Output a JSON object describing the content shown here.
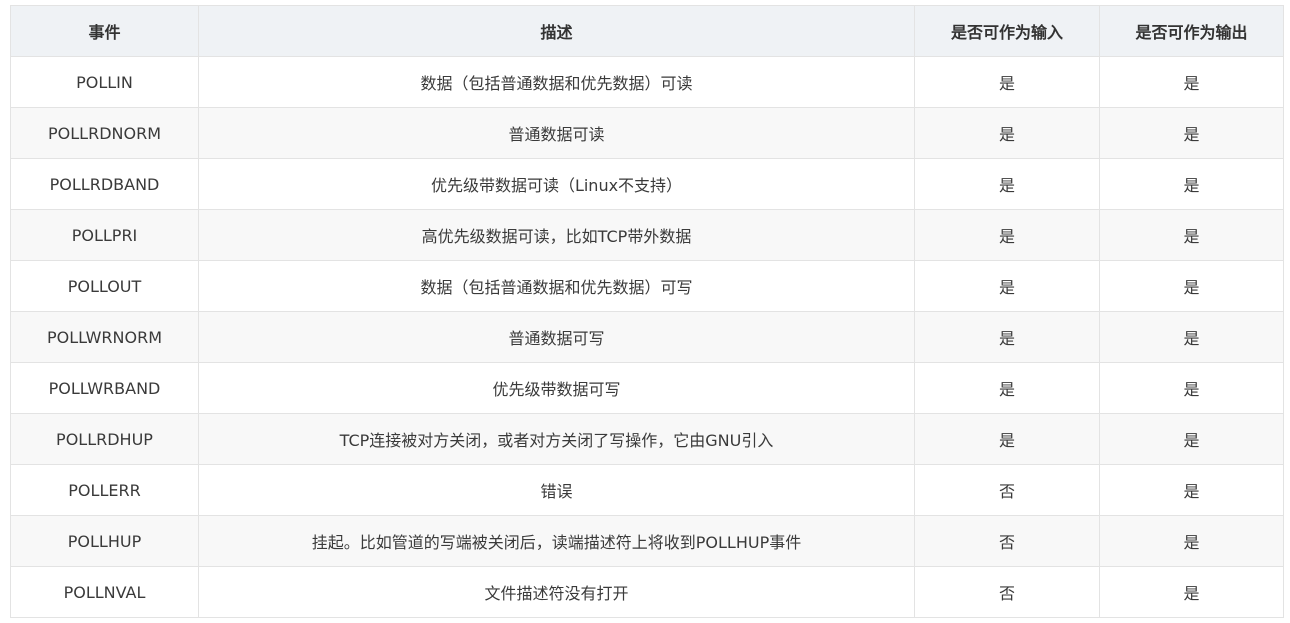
{
  "table": {
    "headers": [
      "事件",
      "描述",
      "是否可作为输入",
      "是否可作为输出"
    ],
    "rows": [
      [
        "POLLIN",
        "数据（包括普通数据和优先数据）可读",
        "是",
        "是"
      ],
      [
        "POLLRDNORM",
        "普通数据可读",
        "是",
        "是"
      ],
      [
        "POLLRDBAND",
        "优先级带数据可读（Linux不支持）",
        "是",
        "是"
      ],
      [
        "POLLPRI",
        "高优先级数据可读，比如TCP带外数据",
        "是",
        "是"
      ],
      [
        "POLLOUT",
        "数据（包括普通数据和优先数据）可写",
        "是",
        "是"
      ],
      [
        "POLLWRNORM",
        "普通数据可写",
        "是",
        "是"
      ],
      [
        "POLLWRBAND",
        "优先级带数据可写",
        "是",
        "是"
      ],
      [
        "POLLRDHUP",
        "TCP连接被对方关闭，或者对方关闭了写操作，它由GNU引入",
        "是",
        "是"
      ],
      [
        "POLLERR",
        "错误",
        "否",
        "是"
      ],
      [
        "POLLHUP",
        "挂起。比如管道的写端被关闭后，读端描述符上将收到POLLHUP事件",
        "否",
        "是"
      ],
      [
        "POLLNVAL",
        "文件描述符没有打开",
        "否",
        "是"
      ]
    ]
  }
}
